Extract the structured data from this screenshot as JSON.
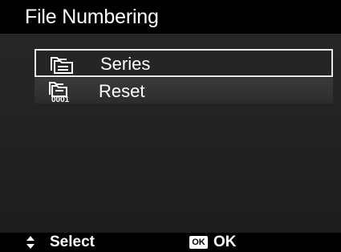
{
  "title": "File Numbering",
  "menu": {
    "items": [
      {
        "label": "Series",
        "icon": "folder-series-icon",
        "selected": true
      },
      {
        "label": "Reset",
        "icon": "folder-reset-0001-icon",
        "selected": false
      }
    ],
    "reset_icon_text": "0001"
  },
  "footer": {
    "select_icon": "up-down-arrows-icon",
    "select_label": "Select",
    "ok_icon_text": "OK",
    "ok_label": "OK"
  },
  "colors": {
    "background": "#000000",
    "panel": "#242424",
    "selection_border": "#e8e8e8",
    "text": "#ffffff"
  }
}
